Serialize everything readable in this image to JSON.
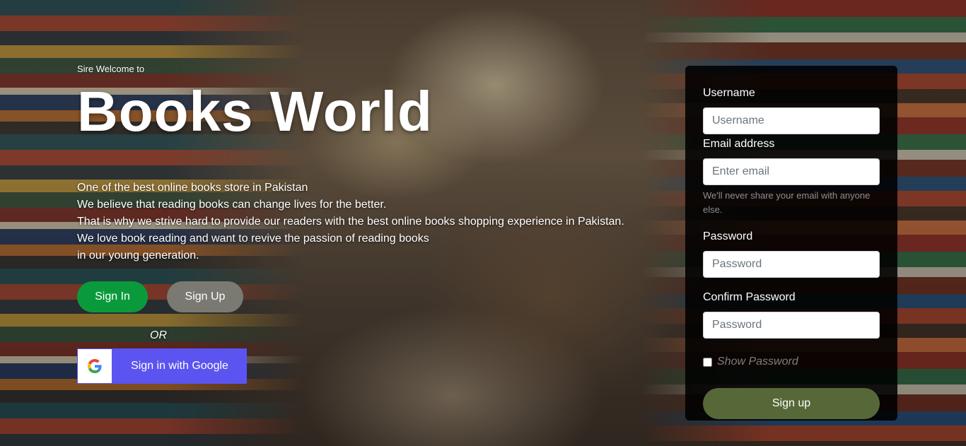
{
  "hero": {
    "eyebrow": "Sire Welcome to",
    "title": "Books World",
    "tagline": [
      "One of the best online books store in Pakistan",
      "We believe that reading books can change lives for the better.",
      "That is why we strive hard to provide our readers with the best online books shopping experience in Pakistan.",
      "We love book reading and want to revive the passion of reading books",
      "in our young generation."
    ]
  },
  "actions": {
    "sign_in_label": "Sign In",
    "sign_up_label": "Sign Up",
    "or_text": "OR",
    "google_label": "Sign in with Google",
    "google_icon": "google-icon"
  },
  "form": {
    "username": {
      "label": "Username",
      "placeholder": "Username"
    },
    "email": {
      "label": "Email address",
      "placeholder": "Enter email",
      "help": "We'll never share your email with anyone else."
    },
    "password": {
      "label": "Password",
      "placeholder": "Password"
    },
    "confirm_password": {
      "label": "Confirm Password",
      "placeholder": "Password"
    },
    "show_password_label": "Show Password",
    "submit_label": "Sign up"
  },
  "colors": {
    "sign_in_green": "#0a9a3c",
    "sign_up_gray": "#7a7a72",
    "google_purple": "#5b54f0",
    "submit_olive": "#566838",
    "panel_bg": "#000000"
  }
}
